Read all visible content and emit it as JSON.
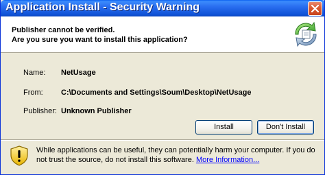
{
  "window": {
    "title": "Application Install - Security Warning"
  },
  "header": {
    "line1": "Publisher cannot be verified.",
    "line2": "Are you sure you want to install this application?",
    "icon": "install-arrows-icon"
  },
  "details": {
    "name_label": "Name:",
    "name_value": "NetUsage",
    "from_label": "From:",
    "from_value": "C:\\Documents and Settings\\Soum\\Desktop\\NetUsage",
    "publisher_label": "Publisher:",
    "publisher_value": "Unknown Publisher"
  },
  "buttons": {
    "install_label": "Install",
    "dont_install_label": "Don't Install"
  },
  "warning": {
    "icon": "warning-shield-icon",
    "text": "While applications can be useful, they can potentially harm your computer. If you do not trust the source, do not install this software. ",
    "link_text": "More Information..."
  },
  "colors": {
    "titlebar": "#0a5ff0",
    "dialog_bg": "#ece9d8",
    "link": "#0000ff",
    "close_button": "#d9582f"
  }
}
